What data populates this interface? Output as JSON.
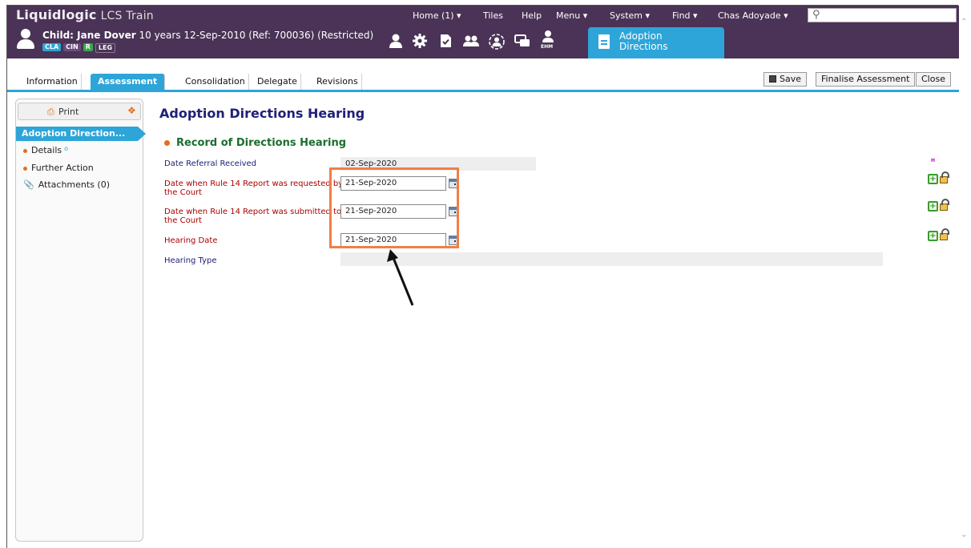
{
  "app": {
    "brand": "Liquidlogic",
    "env": "LCS Train"
  },
  "topnav": {
    "home": "Home (1) ▾",
    "tiles": "Tiles",
    "help": "Help",
    "menu": "Menu ▾",
    "system": "System ▾",
    "find": "Find ▾",
    "user": "Chas Adoyade ▾",
    "search_placeholder": ""
  },
  "child": {
    "title_bold": "Child: Jane Dover",
    "title_rest": "10 years 12-Sep-2010 (Ref: 700036) (Restricted)",
    "badges": [
      {
        "label": "CLA",
        "bg": "#2da5d9",
        "fg": "#ffffff"
      },
      {
        "label": "CIN",
        "bg": "#6a4c7a",
        "fg": "#ffffff"
      },
      {
        "label": "R",
        "bg": "#3aa84a",
        "fg": "#ffffff"
      },
      {
        "label": "LEG",
        "bg": "#4a3356",
        "fg": "#ffffff"
      }
    ],
    "icons": [
      "person-icon",
      "gear-icon",
      "document-check-icon",
      "group-icon",
      "person-network-icon",
      "chat-icon",
      "ehm-person-icon"
    ],
    "ehm_label": "EHM",
    "active_tab": {
      "line1": "Adoption",
      "line2": "Directions"
    }
  },
  "tabs": {
    "information": "Information",
    "assessment": "Assessment",
    "consolidation": "Consolidation",
    "delegate": "Delegate",
    "revisions": "Revisions"
  },
  "actions": {
    "save": "Save",
    "finalise": "Finalise Assessment",
    "close": "Close"
  },
  "sidebar": {
    "print": "Print",
    "active": "Adoption Direction...",
    "details": "Details",
    "details_sup": "o",
    "further_action": "Further Action",
    "attachments": "Attachments (0)"
  },
  "main": {
    "title": "Adoption Directions Hearing",
    "section": "Record of Directions Hearing",
    "h_marker": "H",
    "fields": {
      "referral_label": "Date Referral Received",
      "referral_value": "02-Sep-2020",
      "rule14_req_label_1": "Date when Rule 14 Report was requested by",
      "rule14_req_label_2": "the Court",
      "rule14_req_value": "21-Sep-2020",
      "rule14_sub_label_1": "Date when Rule 14 Report was submitted to",
      "rule14_sub_label_2": "the Court",
      "rule14_sub_value": "21-Sep-2020",
      "hearing_date_label": "Hearing Date",
      "hearing_date_value": "21-Sep-2020",
      "hearing_type_label": "Hearing Type",
      "hearing_type_value": ""
    }
  },
  "colors": {
    "header": "#4a3356",
    "accent": "#2da5d9",
    "highlight": "#f07f45",
    "required_label": "#aa0000",
    "title": "#20207a",
    "section": "#1b6e2e"
  }
}
